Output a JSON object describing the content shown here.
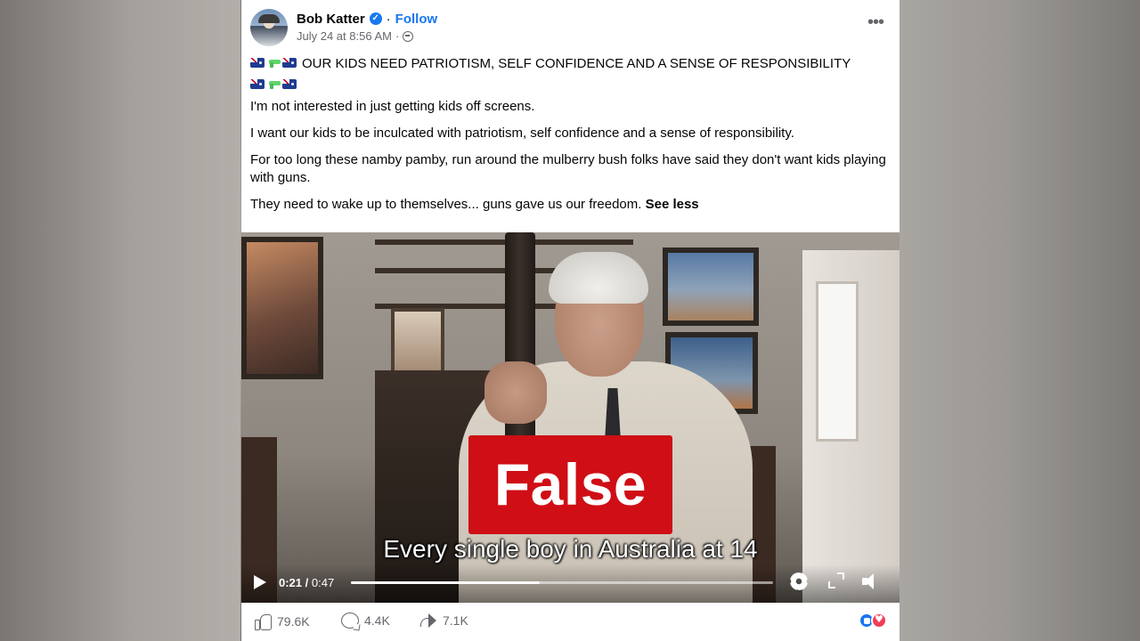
{
  "post": {
    "author": "Bob Katter",
    "follow_label": "Follow",
    "separator": "·",
    "timestamp": "July 24 at 8:56 AM",
    "headline": "OUR KIDS NEED PATRIOTISM, SELF CONFIDENCE AND A SENSE OF RESPONSIBILITY",
    "paragraphs": [
      "I'm not interested in just getting kids off screens.",
      "I want our kids to be inculcated with patriotism, self confidence and a sense of responsibility.",
      "For too long these namby pamby, run around the mulberry bush folks have said they don't want kids playing with guns.",
      "They need to wake up to themselves... guns gave us our freedom."
    ],
    "see_less": "See less",
    "emoji_icons": [
      "australia-flag-icon",
      "water-pistol-icon",
      "australia-flag-icon"
    ]
  },
  "video": {
    "fact_check_label": "False",
    "fact_check_color": "#cf0e15",
    "caption": "Every single boy in Australia at 14",
    "current_time": "0:21",
    "time_separator": " / ",
    "total_time": "0:47",
    "progress_fraction": 0.447
  },
  "engagement": {
    "likes": "79.6K",
    "comments": "4.4K",
    "shares": "7.1K",
    "reaction_icons": [
      "like-reaction-icon",
      "love-reaction-icon"
    ]
  },
  "colors": {
    "link": "#1877f2",
    "secondary_text": "#65676b",
    "primary_text": "#050505"
  }
}
